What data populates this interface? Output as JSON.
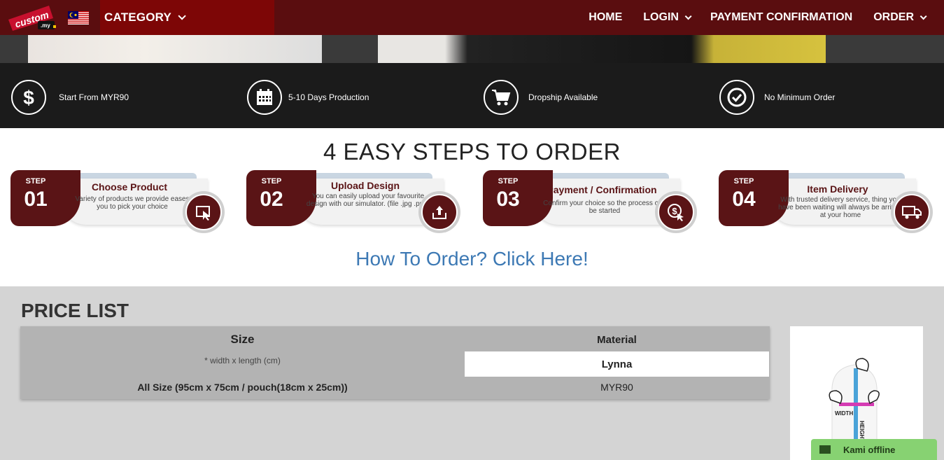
{
  "nav": {
    "logo_text": "custom.my",
    "category_label": "CATEGORY",
    "menu": [
      {
        "label": "HOME",
        "dropdown": false
      },
      {
        "label": "LOGIN",
        "dropdown": true
      },
      {
        "label": "PAYMENT CONFIRMATION",
        "dropdown": false
      },
      {
        "label": "ORDER",
        "dropdown": true
      }
    ]
  },
  "features": [
    {
      "icon": "dollar-icon",
      "label": "Start From MYR90"
    },
    {
      "icon": "calendar-icon",
      "label": "5-10 Days Production"
    },
    {
      "icon": "cart-icon",
      "label": "Dropship Available"
    },
    {
      "icon": "check-circle-icon",
      "label": "No Minimum Order"
    }
  ],
  "steps_title": "4 EASY STEPS TO ORDER",
  "steps": [
    {
      "step_label": "STEP",
      "number": "01",
      "title": "Choose Product",
      "desc": "Variety of products we provide eases you to pick your choice",
      "icon": "pointer-icon"
    },
    {
      "step_label": "STEP",
      "number": "02",
      "title": "Upload Design",
      "desc": "You can easily upload your favourite design with our simulator. (file .jpg .png)",
      "icon": "upload-icon"
    },
    {
      "step_label": "STEP",
      "number": "03",
      "title": "Payment / Confirmation",
      "desc": "Confirm your choice so the process can be started",
      "icon": "payment-icon"
    },
    {
      "step_label": "STEP",
      "number": "04",
      "title": "Item Delivery",
      "desc": "With trusted delivery service, thing you have been waiting will always be arrived at your home",
      "icon": "truck-icon"
    }
  ],
  "how_to_order": "How To Order? Click Here!",
  "price_list": {
    "title": "PRICE LIST",
    "size_header": "Size",
    "size_sub": "* width x length (cm)",
    "material_header": "Material",
    "material_name": "Lynna",
    "row_size": "All Size (95cm x 75cm / pouch(18cm x 25cm))",
    "row_price": "MYR90",
    "diagram_width_label": "WIDTH",
    "diagram_height_label": "HEIGHT"
  },
  "chat": {
    "label": "Kami offline"
  }
}
